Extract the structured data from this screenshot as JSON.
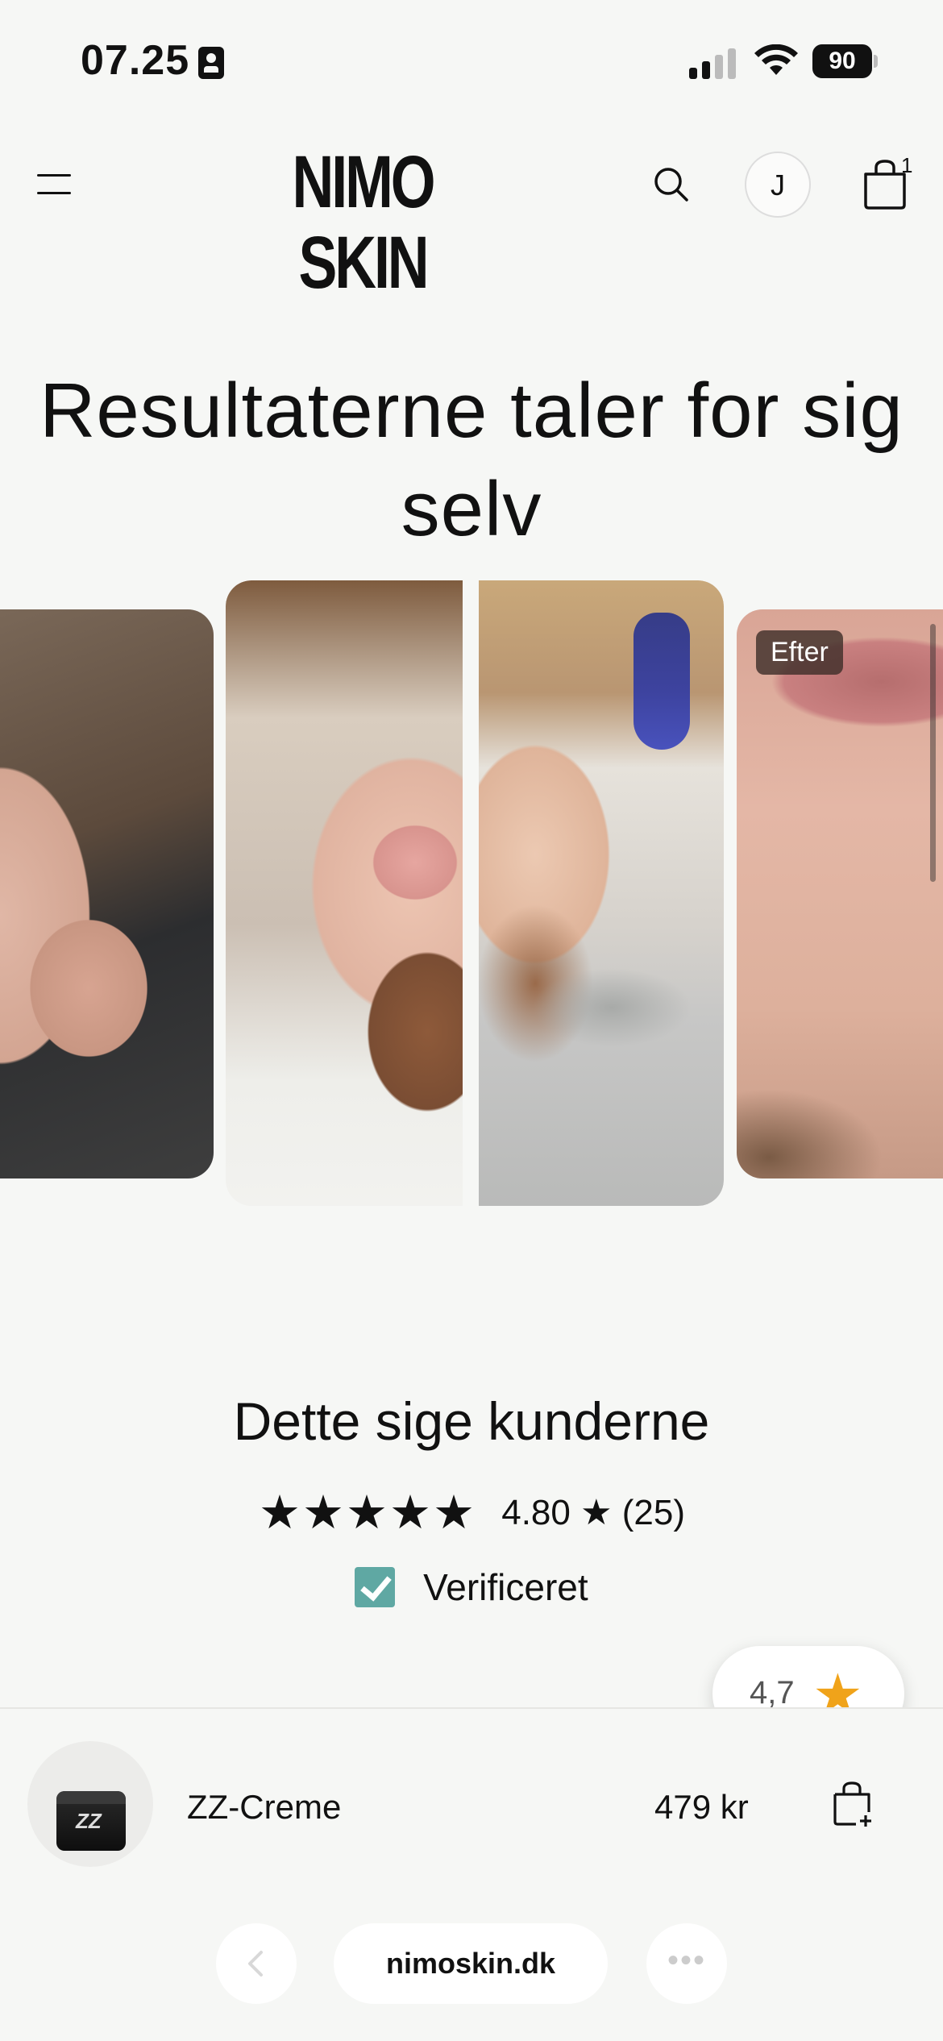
{
  "status_bar": {
    "time": "07.25",
    "battery": "90"
  },
  "header": {
    "logo": "NIMO SKIN",
    "avatar_initial": "J",
    "cart_count": "1"
  },
  "hero": {
    "headline": "Resultaterne taler for sig selv"
  },
  "carousel": {
    "badge_after": "Efter"
  },
  "reviews": {
    "title": "Dette sige kunderne",
    "star_count": 5,
    "score_text": "4.80 ★ (25)",
    "verified_label": "Verificeret"
  },
  "rating_bubble": {
    "value": "4,7",
    "star_color": "#f0a31a"
  },
  "product_bar": {
    "name": "ZZ-Creme",
    "price": "479 kr"
  },
  "browser": {
    "url": "nimoskin.dk",
    "more_label": "•••"
  },
  "colors": {
    "background": "#f6f7f5",
    "verified_check": "#5fa8a3"
  }
}
